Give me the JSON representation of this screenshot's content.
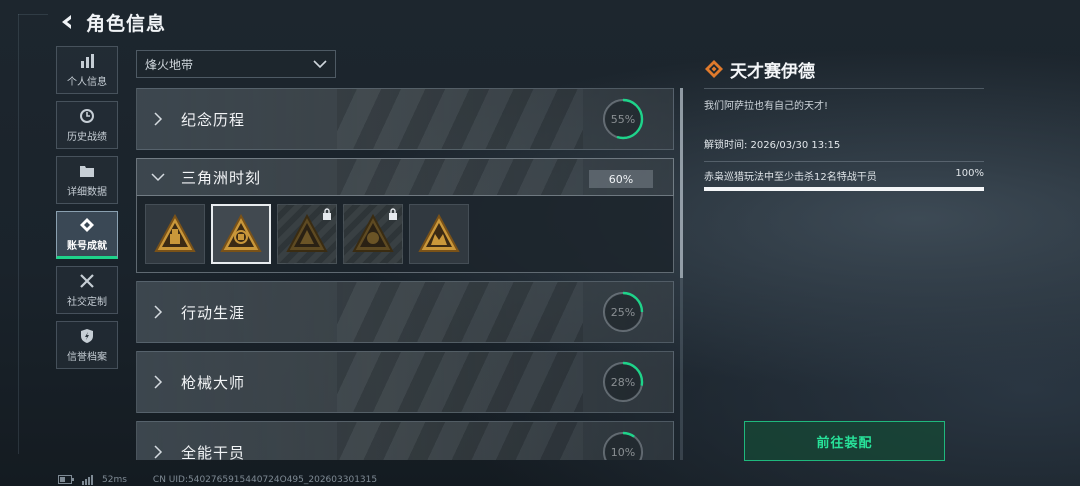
{
  "header": {
    "title": "角色信息"
  },
  "sidebar": {
    "items": [
      {
        "label": "个人信息",
        "icon": "bar-chart-icon",
        "active": false
      },
      {
        "label": "历史战绩",
        "icon": "clock-icon",
        "active": false
      },
      {
        "label": "详细数据",
        "icon": "folder-icon",
        "active": false
      },
      {
        "label": "账号成就",
        "icon": "achievement-icon",
        "active": true
      },
      {
        "label": "社交定制",
        "icon": "tools-icon",
        "active": false
      },
      {
        "label": "信誉档案",
        "icon": "shield-icon",
        "active": false
      }
    ]
  },
  "mode_select": {
    "value": "烽火地带"
  },
  "categories": [
    {
      "name": "纪念历程",
      "percent": "55%",
      "progress": 0.55,
      "expanded": false
    },
    {
      "name": "三角洲时刻",
      "percent": "60%",
      "progress": 0.6,
      "expanded": true
    },
    {
      "name": "行动生涯",
      "percent": "25%",
      "progress": 0.25,
      "expanded": false
    },
    {
      "name": "枪械大师",
      "percent": "28%",
      "progress": 0.28,
      "expanded": false
    },
    {
      "name": "全能干员",
      "percent": "10%",
      "progress": 0.1,
      "expanded": false
    }
  ],
  "badges": [
    {
      "icon": "achievement-badge-icon",
      "locked": false,
      "selected": false
    },
    {
      "icon": "achievement-badge-icon",
      "locked": false,
      "selected": true
    },
    {
      "icon": "achievement-badge-icon",
      "locked": true,
      "selected": false
    },
    {
      "icon": "achievement-badge-icon",
      "locked": true,
      "selected": false
    },
    {
      "icon": "achievement-badge-icon",
      "locked": false,
      "selected": false
    }
  ],
  "detail": {
    "title": "天才赛伊德",
    "description": "我们阿萨拉也有自己的天才!",
    "unlock_label": "解锁时间: 2026/03/30 13:15",
    "requirement": "赤枭巡猎玩法中至少击杀12名特战干员",
    "requirement_percent": "100%",
    "requirement_progress": 1.0
  },
  "equip_button": "前往装配",
  "status_bar": {
    "ping": "52ms",
    "uid": "CN UID:5402765915440724O495_202603301315"
  },
  "colors": {
    "accent": "#1ed38a",
    "badge_gold": "#c9973a",
    "diamond": "#e07a2c"
  }
}
